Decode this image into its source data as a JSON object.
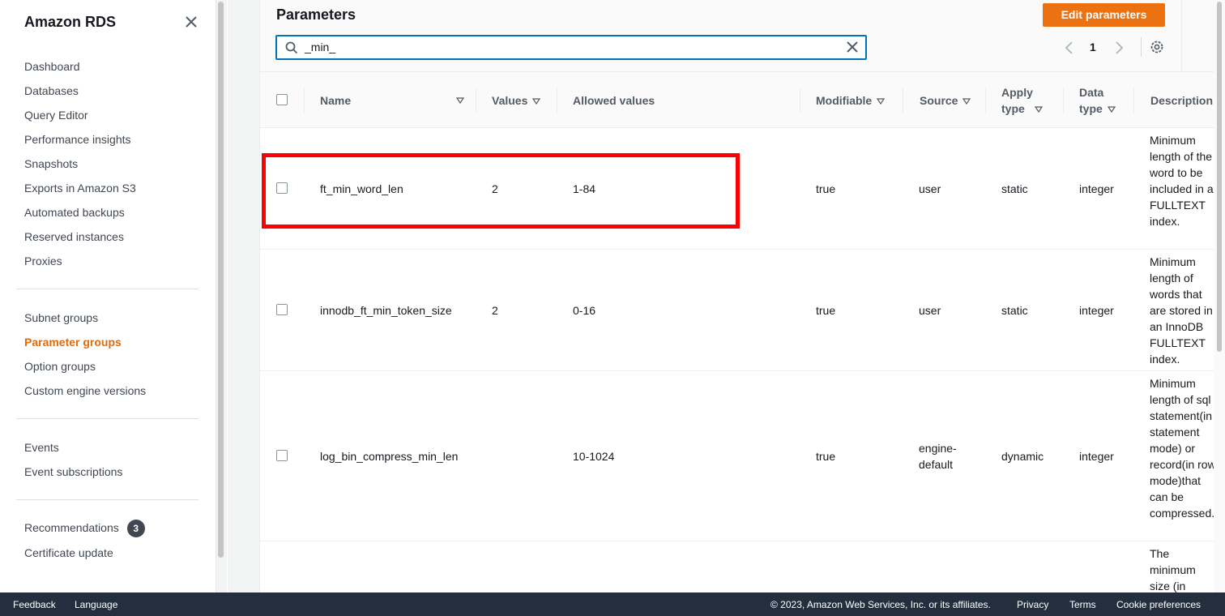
{
  "sidebar": {
    "title": "Amazon RDS",
    "section1": [
      "Dashboard",
      "Databases",
      "Query Editor",
      "Performance insights",
      "Snapshots",
      "Exports in Amazon S3",
      "Automated backups",
      "Reserved instances",
      "Proxies"
    ],
    "section2": [
      "Subnet groups",
      "Parameter groups",
      "Option groups",
      "Custom engine versions"
    ],
    "section3": [
      "Events",
      "Event subscriptions"
    ],
    "recommendations_label": "Recommendations",
    "recommendations_count": "3",
    "certificate_update": "Certificate update",
    "active_item": "Parameter groups"
  },
  "panel": {
    "title": "Parameters",
    "edit_button": "Edit parameters",
    "search_value": "_min_",
    "page_number": "1"
  },
  "table": {
    "headers": {
      "name": "Name",
      "values": "Values",
      "allowed": "Allowed values",
      "modifiable": "Modifiable",
      "source": "Source",
      "apply_type_1": "Apply",
      "apply_type_2": "type",
      "data_type_1": "Data",
      "data_type_2": "type",
      "description": "Description"
    },
    "rows": [
      {
        "name": "ft_min_word_len",
        "value": "2",
        "allowed": "1-84",
        "modifiable": "true",
        "source": "user",
        "apply_type": "static",
        "data_type": "integer",
        "description": "Minimum length of the word to be included in a FULLTEXT index."
      },
      {
        "name": "innodb_ft_min_token_size",
        "value": "2",
        "allowed": "0-16",
        "modifiable": "true",
        "source": "user",
        "apply_type": "static",
        "data_type": "integer",
        "description": "Minimum length of words that are stored in an InnoDB FULLTEXT index."
      },
      {
        "name": "log_bin_compress_min_len",
        "value": "",
        "allowed": "10-1024",
        "modifiable": "true",
        "source_1": "engine-",
        "source_2": "default",
        "apply_type": "dynamic",
        "data_type": "integer",
        "description": "Minimum length of sql statement(in statement mode) or record(in row mode)that can be compressed."
      },
      {
        "description": "The minimum size (in"
      }
    ]
  },
  "footer": {
    "feedback": "Feedback",
    "language": "Language",
    "copyright": "© 2023, Amazon Web Services, Inc. or its affiliates.",
    "privacy": "Privacy",
    "terms": "Terms",
    "cookies": "Cookie preferences"
  },
  "colors": {
    "accent": "#ec7211",
    "active_nav": "#dd6b10",
    "search_border": "#0073bb",
    "footer_bg": "#232f3e",
    "highlight": "#ff0000"
  }
}
